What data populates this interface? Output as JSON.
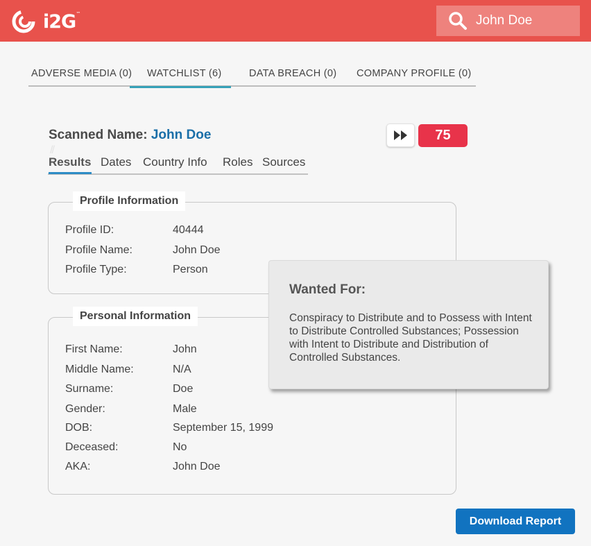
{
  "header": {
    "logo_text": "i2G",
    "logo_tm": "™",
    "search_value": "John Doe"
  },
  "tabs": [
    {
      "label": "ADVERSE MEDIA (0)"
    },
    {
      "label": "WATCHLIST (6)"
    },
    {
      "label": "DATA BREACH (0)"
    },
    {
      "label": "COMPANY PROFILE (0)"
    }
  ],
  "scan": {
    "label": "Scanned Name:",
    "name": "John Doe",
    "marks": "//",
    "score": "75"
  },
  "subtabs": [
    {
      "label": "Results"
    },
    {
      "label": "Dates"
    },
    {
      "label": "Country Info"
    },
    {
      "label": "Roles"
    },
    {
      "label": "Sources"
    }
  ],
  "profile": {
    "title": "Profile Information",
    "rows": [
      {
        "key": "Profile ID:",
        "value": "40444"
      },
      {
        "key": "Profile Name:",
        "value": "John Doe"
      },
      {
        "key": "Profile Type:",
        "value": "Person"
      }
    ]
  },
  "personal": {
    "title": "Personal Information",
    "rows": [
      {
        "key": "First Name:",
        "value": "John"
      },
      {
        "key": "Middle Name:",
        "value": "N/A"
      },
      {
        "key": "Surname:",
        "value": "Doe"
      },
      {
        "key": "Gender:",
        "value": "Male"
      },
      {
        "key": "DOB:",
        "value": "September 15, 1999"
      },
      {
        "key": "Deceased:",
        "value": "No"
      },
      {
        "key": "AKA:",
        "value": "John Doe"
      }
    ]
  },
  "popup": {
    "title": "Wanted For:",
    "body": "Conspiracy to Distribute and to Possess with Intent to Distribute Controlled Substances; Possession with Intent to Distribute and Distribution of Controlled Substances."
  },
  "download_label": "Download Report",
  "colors": {
    "header": "#e8524c",
    "active_tab": "#36a1b8",
    "score_badge": "#e8334a",
    "button": "#1173c0",
    "name_link": "#1a6fa8"
  }
}
